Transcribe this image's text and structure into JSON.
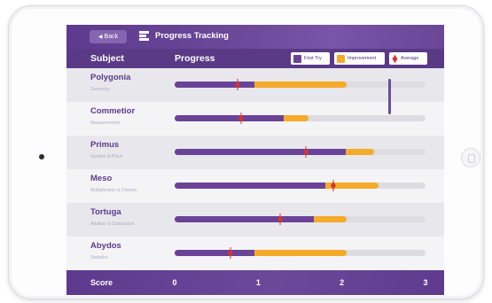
{
  "header": {
    "back_label": "Back",
    "title": "Progress Tracking"
  },
  "columns": {
    "subject": "Subject",
    "progress": "Progress"
  },
  "legend": {
    "first_try": "First Try",
    "improvement": "Improvement",
    "average": "Average"
  },
  "colors": {
    "first_try": "#6a4398",
    "improvement": "#f6aa2a",
    "average": "#d8322e",
    "track": "#dcdce1"
  },
  "scale": {
    "min": 0,
    "max": 3
  },
  "subjects": [
    {
      "name": "Polygonia",
      "category": "Geometry",
      "first_try": 0.95,
      "improvement": 2.06,
      "average": 0.75
    },
    {
      "name": "Commetior",
      "category": "Measurements",
      "first_try": 1.3,
      "improvement": 1.6,
      "average": 0.8
    },
    {
      "name": "Primus",
      "category": "Number & Place",
      "first_try": 2.05,
      "improvement": 2.38,
      "average": 1.57
    },
    {
      "name": "Meso",
      "category": "Multiplication & Division",
      "first_try": 1.8,
      "improvement": 2.44,
      "average": 1.9
    },
    {
      "name": "Tortuga",
      "category": "Addition & Subtraction",
      "first_try": 1.66,
      "improvement": 2.06,
      "average": 1.26
    },
    {
      "name": "Abydos",
      "category": "Statistics",
      "first_try": 0.95,
      "improvement": 2.06,
      "average": 0.67
    }
  ],
  "footer": {
    "score_label": "Score",
    "ticks": [
      "0",
      "1",
      "2",
      "3"
    ]
  }
}
